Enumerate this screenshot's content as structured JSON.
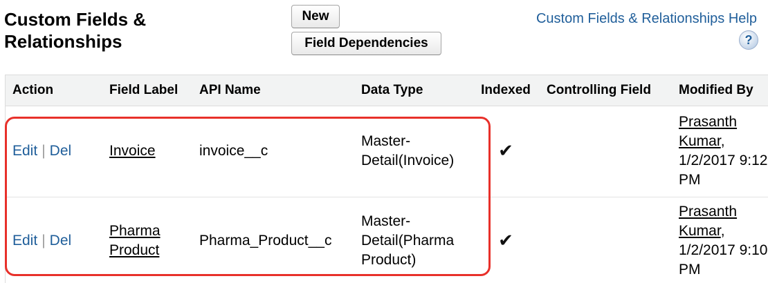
{
  "page": {
    "title_line1": "Custom Fields &",
    "title_line2": "Relationships",
    "help_link": "Custom Fields & Relationships Help",
    "help_icon": "?"
  },
  "toolbar": {
    "new_label": "New",
    "field_dependencies_label": "Field Dependencies"
  },
  "table": {
    "columns": [
      "Action",
      "Field Label",
      "API Name",
      "Data Type",
      "Indexed",
      "Controlling Field",
      "Modified By"
    ],
    "rows": [
      {
        "edit": "Edit",
        "del": "Del",
        "field_label": "Invoice",
        "api_name": "invoice__c",
        "data_type": "Master-Detail(Invoice)",
        "indexed": "✔",
        "controlling_field": "",
        "modified_by_name": "Prasanth Kumar",
        "modified_by_date": ", 1/2/2017 9:12 PM"
      },
      {
        "edit": "Edit",
        "del": "Del",
        "field_label": "Pharma Product",
        "api_name": "Pharma_Product__c",
        "data_type": "Master-Detail(Pharma Product)",
        "indexed": "✔",
        "controlling_field": "",
        "modified_by_name": "Prasanth Kumar",
        "modified_by_date": ", 1/2/2017 9:10 PM"
      }
    ]
  },
  "colors": {
    "link": "#1f5e9a",
    "header_bg": "#f2f3f3",
    "highlight": "#e8302a"
  }
}
